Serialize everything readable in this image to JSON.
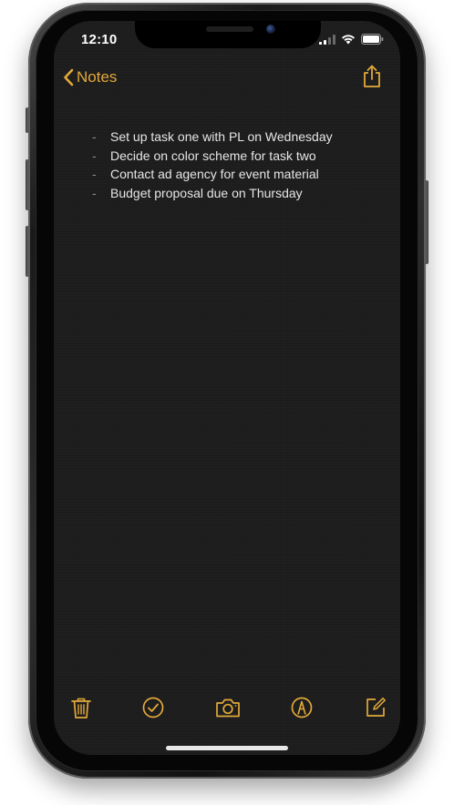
{
  "status_bar": {
    "time": "12:10"
  },
  "nav": {
    "back_label": "Notes"
  },
  "note": {
    "items": [
      {
        "bullet": "-",
        "text": "Set up task one with PL on Wednesday"
      },
      {
        "bullet": "-",
        "text": "Decide on color scheme for task two"
      },
      {
        "bullet": "-",
        "text": "Contact ad agency for event material"
      },
      {
        "bullet": "-",
        "text": "Budget proposal due on Thursday"
      }
    ]
  },
  "toolbar": {
    "icons": [
      "trash-icon",
      "checklist-icon",
      "camera-icon",
      "markup-icon",
      "compose-icon"
    ]
  },
  "colors": {
    "accent": "#e2a93a",
    "background": "#1d1d1d",
    "text": "#e6e6e6"
  }
}
